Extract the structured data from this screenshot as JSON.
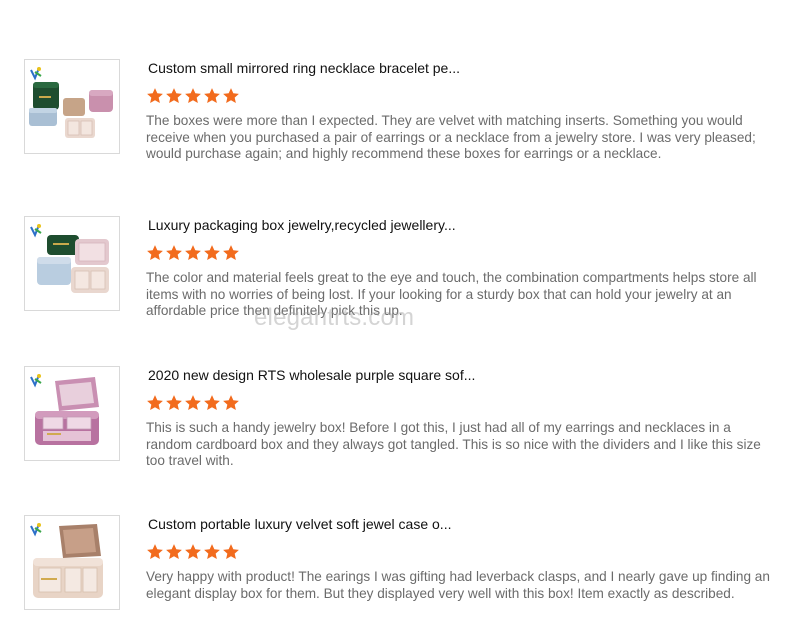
{
  "reviews": [
    {
      "title": "Custom small mirrored ring necklace bracelet pe...",
      "rating": 5,
      "text": "The boxes were more than I expected. They are velvet with matching inserts. Something you would receive when you purchased a pair of earrings or a necklace from a jewelry store. I was very pleased; would purchase again; and highly recommend these boxes for earrings or a necklace."
    },
    {
      "title": "Luxury packaging box jewelry,recycled jewellery...",
      "rating": 5,
      "text": "The color and material feels great to the eye and touch, the combination compartments helps store all  items with no worries of being lost. If your looking for a sturdy box that can hold your jewelry at an affordable price then definitely pick this up."
    },
    {
      "title": "2020 new design RTS wholesale purple square sof...",
      "rating": 5,
      "text": "This is such a handy jewelry box! Before I got this, I just had all of my earrings and necklaces in a random cardboard box and they always got tangled. This is so nice with the dividers and I like this size too travel with."
    },
    {
      "title": "Custom portable luxury velvet soft jewel case o...",
      "rating": 5,
      "text": "Very happy with product! The earings I was gifting had leverback clasps, and I nearly gave up finding an elegant display box for them. But they displayed very well with this box! Item exactly as described."
    }
  ],
  "star_color": "#f26b1d",
  "watermark": "elegantrts.com"
}
